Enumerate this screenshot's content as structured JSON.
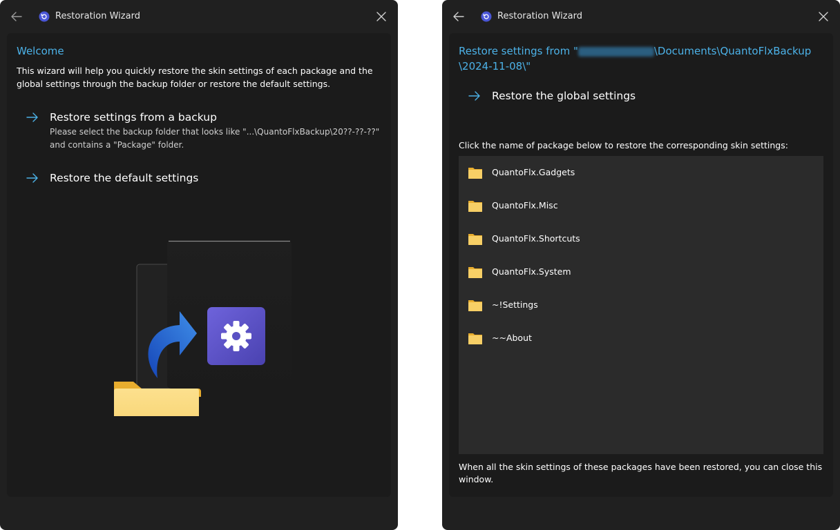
{
  "window1": {
    "title": "Restoration Wizard",
    "heading": "Welcome",
    "intro": "This wizard will help you quickly restore the skin settings of each package and the global settings through the backup folder or restore the default settings.",
    "option_backup": {
      "label": "Restore settings from a backup",
      "desc_line1": "Please select the backup folder that looks like \"...\\QuantoFlxBackup\\20??-??-??\"",
      "desc_line2": "and contains a \"Package\" folder."
    },
    "option_default": {
      "label": "Restore the default settings"
    },
    "illustration": "folder-restore-settings-illustration"
  },
  "window2": {
    "title": "Restoration Wizard",
    "heading_prefix": "Restore settings from \"",
    "heading_suffix": "\\Documents\\QuantoFlxBackup",
    "heading_line2": "\\2024-11-08\\\"",
    "option_global": {
      "label": "Restore the global settings"
    },
    "instruction": "Click the name of package below to restore the corresponding skin settings:",
    "packages": [
      {
        "name": "QuantoFlx.Gadgets"
      },
      {
        "name": "QuantoFlx.Misc"
      },
      {
        "name": "QuantoFlx.Shortcuts"
      },
      {
        "name": "QuantoFlx.System"
      },
      {
        "name": "~!Settings"
      },
      {
        "name": "~~About"
      }
    ],
    "footer_line1": "When all the skin settings of these packages have been restored, you can close this",
    "footer_line2": "window."
  },
  "colors": {
    "accent": "#4cb2e8",
    "window_bg": "#202020",
    "card_bg": "#1b1b1b",
    "list_bg": "#2b2b2b",
    "folder_yellow": "#f6c85a",
    "gear_tile": "#5b53c8"
  }
}
